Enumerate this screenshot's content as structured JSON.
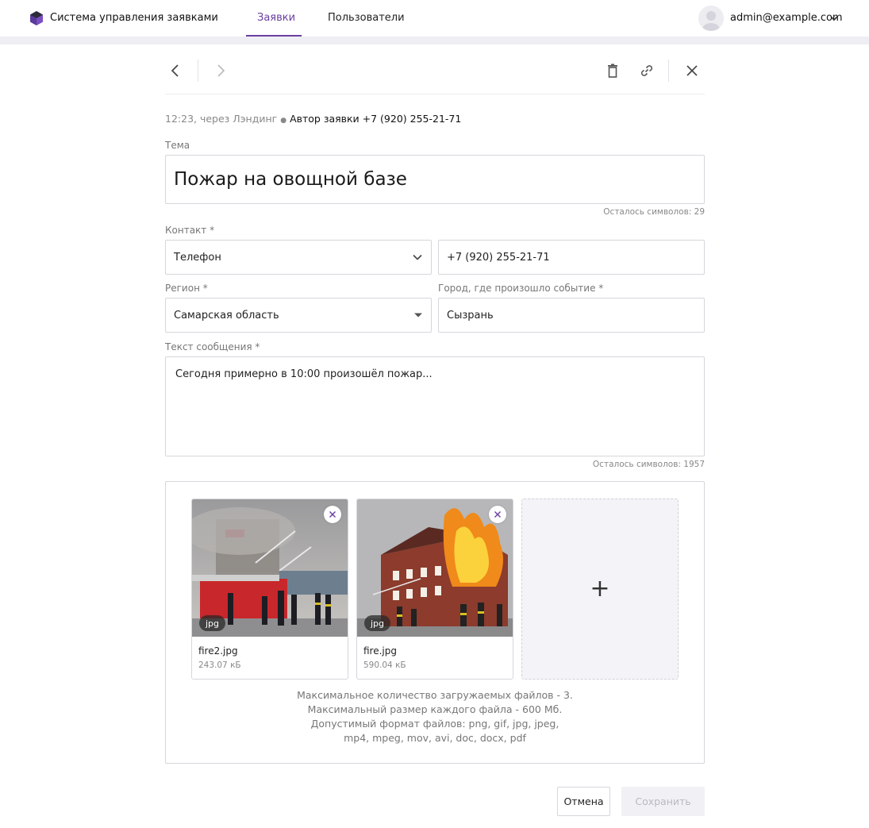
{
  "app": {
    "title": "Система управления заявками"
  },
  "nav": {
    "tabs": [
      {
        "label": "Заявки",
        "active": true
      },
      {
        "label": "Пользователи",
        "active": false
      }
    ]
  },
  "user": {
    "email": "admin@example.com"
  },
  "meta": {
    "time_source": "12:23, через Лэндинг",
    "separator": "●",
    "author": "Автор заявки +7 (920) 255-21-71"
  },
  "form": {
    "subject": {
      "label": "Тема",
      "value": "Пожар на овощной базе",
      "counter": "Осталось символов: 29"
    },
    "contact": {
      "label": "Контакт *",
      "type_value": "Телефон",
      "value": "+7 (920) 255-21-71"
    },
    "region": {
      "label": "Регион *",
      "value": "Самарская область"
    },
    "city": {
      "label": "Город, где произошло событие *",
      "value": "Сызрань"
    },
    "message": {
      "label": "Текст сообщения *",
      "value": "Сегодня примерно в 10:00 произошёл пожар...",
      "counter": "Осталось символов: 1957"
    }
  },
  "attachments": {
    "files": [
      {
        "name": "fire2.jpg",
        "size": "243.07 кБ",
        "ext": "jpg"
      },
      {
        "name": "fire.jpg",
        "size": "590.04 кБ",
        "ext": "jpg"
      }
    ],
    "add_symbol": "+",
    "info": [
      "Максимальное количество загружаемых файлов - 3.",
      "Максимальный размер каждого файла - 600 Мб.",
      "Допустимый формат файлов: png, gif, jpg, jpeg,",
      "mp4, mpeg, mov, avi, doc, docx, pdf"
    ]
  },
  "actions": {
    "cancel": "Отмена",
    "save": "Сохранить"
  },
  "colors": {
    "accent": "#6a3fa1",
    "border": "#d6d6dc",
    "muted": "#888888"
  },
  "icons": {
    "back": "chevron-left-icon",
    "forward": "chevron-right-icon",
    "delete": "trash-icon",
    "link": "link-icon",
    "close": "close-icon"
  }
}
